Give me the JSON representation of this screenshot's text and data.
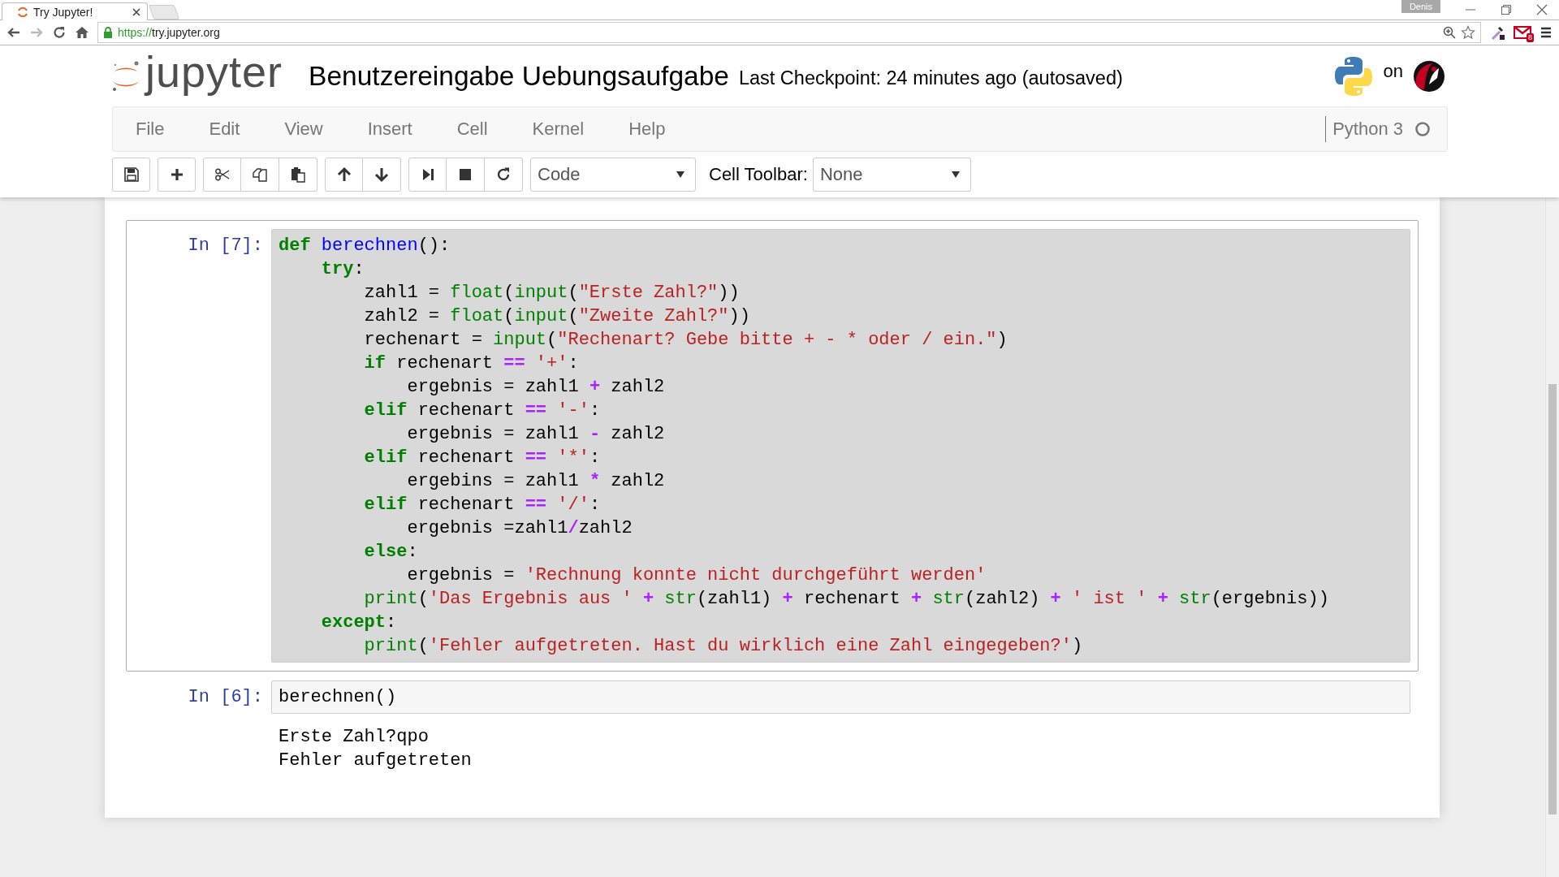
{
  "browser": {
    "tab_title": "Try Jupyter!",
    "url_scheme": "https://",
    "url_host": "try.jupyter.org",
    "profile": "Denis",
    "mail_badge": "8"
  },
  "header": {
    "logo_text": "jupyter",
    "notebook_name": "Benutzereingabe Uebungsaufgabe",
    "checkpoint": "Last Checkpoint: 24 minutes ago (autosaved)",
    "on_text": "on"
  },
  "menu": [
    "File",
    "Edit",
    "View",
    "Insert",
    "Cell",
    "Kernel",
    "Help"
  ],
  "kernel": {
    "name": "Python 3",
    "busy": false
  },
  "toolbar": {
    "cell_type": "Code",
    "cell_toolbar_label": "Cell Toolbar:",
    "cell_toolbar_value": "None"
  },
  "cells": [
    {
      "prompt": "In [7]:",
      "selected": true,
      "lines": [
        [
          {
            "kind": "keyword",
            "text": "def "
          },
          {
            "kind": "function",
            "text": "berechnen"
          },
          {
            "kind": "plain",
            "text": "():"
          }
        ],
        [
          {
            "kind": "keyword",
            "text": "    try"
          },
          {
            "kind": "plain",
            "text": ":"
          }
        ],
        [
          {
            "kind": "plain",
            "text": "        zahl1 = "
          },
          {
            "kind": "builtin",
            "text": "float"
          },
          {
            "kind": "plain",
            "text": "("
          },
          {
            "kind": "builtin",
            "text": "input"
          },
          {
            "kind": "plain",
            "text": "("
          },
          {
            "kind": "string",
            "text": "\"Erste Zahl?\""
          },
          {
            "kind": "plain",
            "text": "))"
          }
        ],
        [
          {
            "kind": "plain",
            "text": "        zahl2 = "
          },
          {
            "kind": "builtin",
            "text": "float"
          },
          {
            "kind": "plain",
            "text": "("
          },
          {
            "kind": "builtin",
            "text": "input"
          },
          {
            "kind": "plain",
            "text": "("
          },
          {
            "kind": "string",
            "text": "\"Zweite Zahl?\""
          },
          {
            "kind": "plain",
            "text": "))"
          }
        ],
        [
          {
            "kind": "plain",
            "text": "        rechenart = "
          },
          {
            "kind": "builtin",
            "text": "input"
          },
          {
            "kind": "plain",
            "text": "("
          },
          {
            "kind": "string",
            "text": "\"Rechenart? Gebe bitte + - * oder / ein.\""
          },
          {
            "kind": "plain",
            "text": ")"
          }
        ],
        [
          {
            "kind": "keyword",
            "text": "        if"
          },
          {
            "kind": "plain",
            "text": " rechenart "
          },
          {
            "kind": "operator",
            "text": "=="
          },
          {
            "kind": "string",
            "text": " '+'"
          },
          {
            "kind": "plain",
            "text": ":"
          }
        ],
        [
          {
            "kind": "plain",
            "text": "            ergebnis = zahl1 "
          },
          {
            "kind": "operator",
            "text": "+"
          },
          {
            "kind": "plain",
            "text": " zahl2"
          }
        ],
        [
          {
            "kind": "keyword",
            "text": "        elif"
          },
          {
            "kind": "plain",
            "text": " rechenart "
          },
          {
            "kind": "operator",
            "text": "=="
          },
          {
            "kind": "string",
            "text": " '-'"
          },
          {
            "kind": "plain",
            "text": ":"
          }
        ],
        [
          {
            "kind": "plain",
            "text": "            ergebnis = zahl1 "
          },
          {
            "kind": "operator",
            "text": "-"
          },
          {
            "kind": "plain",
            "text": " zahl2"
          }
        ],
        [
          {
            "kind": "keyword",
            "text": "        elif"
          },
          {
            "kind": "plain",
            "text": " rechenart "
          },
          {
            "kind": "operator",
            "text": "=="
          },
          {
            "kind": "string",
            "text": " '*'"
          },
          {
            "kind": "plain",
            "text": ":"
          }
        ],
        [
          {
            "kind": "plain",
            "text": "            ergebins = zahl1 "
          },
          {
            "kind": "operator",
            "text": "*"
          },
          {
            "kind": "plain",
            "text": " zahl2"
          }
        ],
        [
          {
            "kind": "keyword",
            "text": "        elif"
          },
          {
            "kind": "plain",
            "text": " rechenart "
          },
          {
            "kind": "operator",
            "text": "=="
          },
          {
            "kind": "string",
            "text": " '/'"
          },
          {
            "kind": "plain",
            "text": ":"
          }
        ],
        [
          {
            "kind": "plain",
            "text": "            ergebnis =zahl1"
          },
          {
            "kind": "operator",
            "text": "/"
          },
          {
            "kind": "plain",
            "text": "zahl2"
          }
        ],
        [
          {
            "kind": "keyword",
            "text": "        else"
          },
          {
            "kind": "plain",
            "text": ":"
          }
        ],
        [
          {
            "kind": "plain",
            "text": "            ergebnis = "
          },
          {
            "kind": "string",
            "text": "'Rechnung konnte nicht durchgeführt werden'"
          }
        ],
        [
          {
            "kind": "builtin",
            "text": "        print"
          },
          {
            "kind": "plain",
            "text": "("
          },
          {
            "kind": "string",
            "text": "'Das Ergebnis aus '"
          },
          {
            "kind": "operator",
            "text": " + "
          },
          {
            "kind": "builtin",
            "text": "str"
          },
          {
            "kind": "plain",
            "text": "(zahl1) "
          },
          {
            "kind": "operator",
            "text": "+"
          },
          {
            "kind": "plain",
            "text": " rechenart "
          },
          {
            "kind": "operator",
            "text": "+ "
          },
          {
            "kind": "builtin",
            "text": "str"
          },
          {
            "kind": "plain",
            "text": "(zahl2) "
          },
          {
            "kind": "operator",
            "text": "+ "
          },
          {
            "kind": "string",
            "text": "' ist '"
          },
          {
            "kind": "operator",
            "text": " + "
          },
          {
            "kind": "builtin",
            "text": "str"
          },
          {
            "kind": "plain",
            "text": "(ergebnis))"
          }
        ],
        [
          {
            "kind": "keyword",
            "text": "    except"
          },
          {
            "kind": "plain",
            "text": ":"
          }
        ],
        [
          {
            "kind": "builtin",
            "text": "        print"
          },
          {
            "kind": "plain",
            "text": "("
          },
          {
            "kind": "string",
            "text": "'Fehler aufgetreten. Hast du wirklich eine Zahl eingegeben?'"
          },
          {
            "kind": "plain",
            "text": ")"
          }
        ]
      ]
    },
    {
      "prompt": "In [6]:",
      "selected": false,
      "lines": [
        [
          {
            "kind": "plain",
            "text": "berechnen()"
          }
        ]
      ],
      "output": [
        "Erste Zahl?qpo",
        "Fehler aufgetreten"
      ]
    }
  ]
}
